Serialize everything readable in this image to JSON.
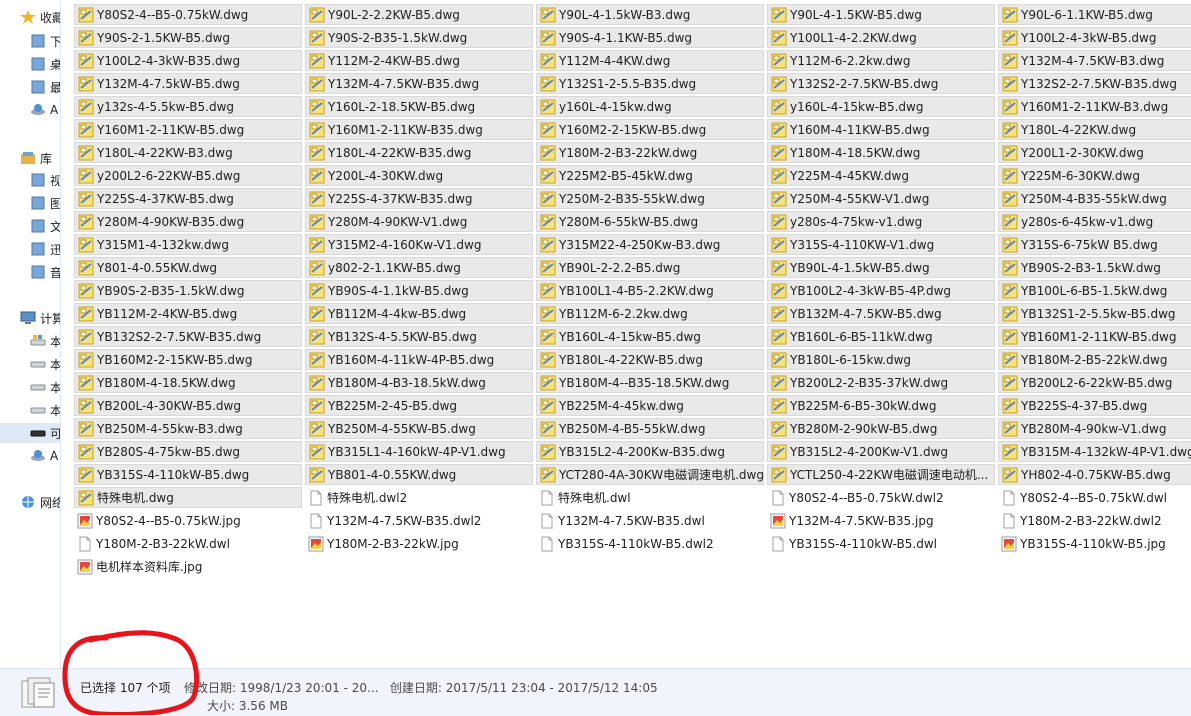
{
  "nav": [
    {
      "label": "收藏夹",
      "icon": "star-icon"
    },
    {
      "label": "下载",
      "icon": "download-folder-icon"
    },
    {
      "label": "桌面",
      "icon": "desktop-icon"
    },
    {
      "label": "最近访问的位置",
      "icon": "recent-places-icon"
    },
    {
      "label": "A",
      "icon": "network-drive-icon"
    },
    {
      "label": "库",
      "icon": "library-icon"
    },
    {
      "label": "视频",
      "icon": "video-library-icon"
    },
    {
      "label": "图片",
      "icon": "picture-library-icon"
    },
    {
      "label": "文档",
      "icon": "document-library-icon"
    },
    {
      "label": "迅雷下载",
      "icon": "download-library-icon"
    },
    {
      "label": "音乐",
      "icon": "music-library-icon"
    },
    {
      "label": "计算机",
      "icon": "computer-icon"
    },
    {
      "label": "本地磁盘",
      "icon": "system-drive-icon"
    },
    {
      "label": "本地磁盘",
      "icon": "drive-icon"
    },
    {
      "label": "本地磁盘",
      "icon": "drive-icon"
    },
    {
      "label": "本地磁盘",
      "icon": "drive-icon"
    },
    {
      "label": "可移动磁盘",
      "icon": "removable-drive-icon"
    },
    {
      "label": "A",
      "icon": "network-drive-icon"
    },
    {
      "label": "网络",
      "icon": "network-icon"
    }
  ],
  "files": [
    [
      "Y80S2-4--B5-0.75kW.dwg",
      "Y90L-2-2.2KW-B5.dwg",
      "Y90L-4-1.5kW-B3.dwg",
      "Y90L-4-1.5KW-B5.dwg",
      "Y90L-6-1.1KW-B5.dwg"
    ],
    [
      "Y90S-2-1.5KW-B5.dwg",
      "Y90S-2-B35-1.5kW.dwg",
      "Y90S-4-1.1KW-B5.dwg",
      "Y100L1-4-2.2KW.dwg",
      "Y100L2-4-3kW-B5.dwg"
    ],
    [
      "Y100L2-4-3kW-B35.dwg",
      "Y112M-2-4KW-B5.dwg",
      "Y112M-4-4KW.dwg",
      "Y112M-6-2.2kw.dwg",
      "Y132M-4-7.5KW-B3.dwg"
    ],
    [
      "Y132M-4-7.5kW-B5.dwg",
      "Y132M-4-7.5KW-B35.dwg",
      "Y132S1-2-5.5-B35.dwg",
      "Y132S2-2-7.5KW-B5.dwg",
      "Y132S2-2-7.5KW-B35.dwg"
    ],
    [
      "y132s-4-5.5kw-B5.dwg",
      "Y160L-2-18.5KW-B5.dwg",
      "y160L-4-15kw.dwg",
      "y160L-4-15kw-B5.dwg",
      "Y160M1-2-11KW-B3.dwg"
    ],
    [
      "Y160M1-2-11KW-B5.dwg",
      "Y160M1-2-11KW-B35.dwg",
      "Y160M2-2-15KW-B5.dwg",
      "Y160M-4-11KW-B5.dwg",
      "Y180L-4-22KW.dwg"
    ],
    [
      "Y180L-4-22KW-B3.dwg",
      "Y180L-4-22KW-B35.dwg",
      "Y180M-2-B3-22kW.dwg",
      "Y180M-4-18.5KW.dwg",
      "Y200L1-2-30KW.dwg"
    ],
    [
      "y200L2-6-22KW-B5.dwg",
      "Y200L-4-30KW.dwg",
      "Y225M2-B5-45kW.dwg",
      "Y225M-4-45KW.dwg",
      "Y225M-6-30KW.dwg"
    ],
    [
      "Y225S-4-37KW-B5.dwg",
      "Y225S-4-37KW-B35.dwg",
      "Y250M-2-B35-55kW.dwg",
      "Y250M-4-55KW-V1.dwg",
      "Y250M-4-B35-55kW.dwg"
    ],
    [
      "Y280M-4-90KW-B35.dwg",
      "Y280M-4-90KW-V1.dwg",
      "Y280M-6-55kW-B5.dwg",
      "y280s-4-75kw-v1.dwg",
      "y280s-6-45kw-v1.dwg"
    ],
    [
      "Y315M1-4-132kw.dwg",
      "Y315M2-4-160Kw-V1.dwg",
      "Y315M22-4-250Kw-B3.dwg",
      "Y315S-4-110KW-V1.dwg",
      "Y315S-6-75kW B5.dwg"
    ],
    [
      "Y801-4-0.55KW.dwg",
      "y802-2-1.1KW-B5.dwg",
      "YB90L-2-2.2-B5.dwg",
      "YB90L-4-1.5kW-B5.dwg",
      "YB90S-2-B3-1.5kW.dwg"
    ],
    [
      "YB90S-2-B35-1.5kW.dwg",
      "YB90S-4-1.1kW-B5.dwg",
      "YB100L1-4-B5-2.2KW.dwg",
      "YB100L2-4-3kW-B5-4P.dwg",
      "YB100L-6-B5-1.5kW.dwg"
    ],
    [
      "YB112M-2-4KW-B5.dwg",
      "YB112M-4-4kw-B5.dwg",
      "YB112M-6-2.2kw.dwg",
      "YB132M-4-7.5KW-B5.dwg",
      "YB132S1-2-5.5kw-B5.dwg"
    ],
    [
      "YB132S2-2-7.5KW-B35.dwg",
      "YB132S-4-5.5KW-B5.dwg",
      "YB160L-4-15kw-B5.dwg",
      "YB160L-6-B5-11kW.dwg",
      "YB160M1-2-11KW-B5.dwg"
    ],
    [
      "YB160M2-2-15KW-B5.dwg",
      "YB160M-4-11kW-4P-B5.dwg",
      "YB180L-4-22KW-B5.dwg",
      "YB180L-6-15kw.dwg",
      "YB180M-2-B5-22kW.dwg"
    ],
    [
      "YB180M-4-18.5KW.dwg",
      "YB180M-4-B3-18.5kW.dwg",
      "YB180M-4--B35-18.5KW.dwg",
      "YB200L2-2-B35-37kW.dwg",
      "YB200L2-6-22kW-B5.dwg"
    ],
    [
      "YB200L-4-30KW-B5.dwg",
      "YB225M-2-45-B5.dwg",
      "YB225M-4-45kw.dwg",
      "YB225M-6-B5-30kW.dwg",
      "YB225S-4-37-B5.dwg"
    ],
    [
      "YB250M-4-55kw-B3.dwg",
      "YB250M-4-55KW-B5.dwg",
      "YB250M-4-B5-55kW.dwg",
      "YB280M-2-90kW-B5.dwg",
      "YB280M-4-90kw-V1.dwg"
    ],
    [
      "YB280S-4-75kw-B5.dwg",
      "YB315L1-4-160kW-4P-V1.dwg",
      "YB315L2-4-200Kw-B35.dwg",
      "YB315L2-4-200Kw-V1.dwg",
      "YB315M-4-132kW-4P-V1.dwg"
    ],
    [
      "YB315S-4-110kW-B5.dwg",
      "YB801-4-0.55KW.dwg",
      "YCT280-4A-30KW电磁调速电机.dwg",
      "YCTL250-4-22KW电磁调速电动机...",
      "YH802-4-0.75KW-B5.dwg"
    ],
    [
      "特殊电机.dwg",
      "特殊电机.dwl2",
      "特殊电机.dwl",
      "Y80S2-4--B5-0.75kW.dwl2",
      "Y80S2-4--B5-0.75kW.dwl"
    ],
    [
      "Y80S2-4--B5-0.75kW.jpg",
      "Y132M-4-7.5KW-B35.dwl2",
      "Y132M-4-7.5KW-B35.dwl",
      "Y132M-4-7.5KW-B35.jpg",
      "Y180M-2-B3-22kW.dwl2"
    ],
    [
      "Y180M-2-B3-22kW.dwl",
      "Y180M-2-B3-22kW.jpg",
      "YB315S-4-110kW-B5.dwl2",
      "YB315S-4-110kW-B5.dwl",
      "YB315S-4-110kW-B5.jpg"
    ],
    [
      "电机样本资料库.jpg"
    ]
  ],
  "status": {
    "selected": "已选择 107 个项",
    "modified": "修改日期: 1998/1/23 20:01 - 20...",
    "created": "创建日期: 2017/5/11 23:04 - 2017/5/12 14:05",
    "size": "大小: 3.56 MB"
  },
  "colors": {
    "selection_bg": "#e9e9e9",
    "status_bg": "#f1f5fb",
    "annotation_red": "#e8141b"
  }
}
